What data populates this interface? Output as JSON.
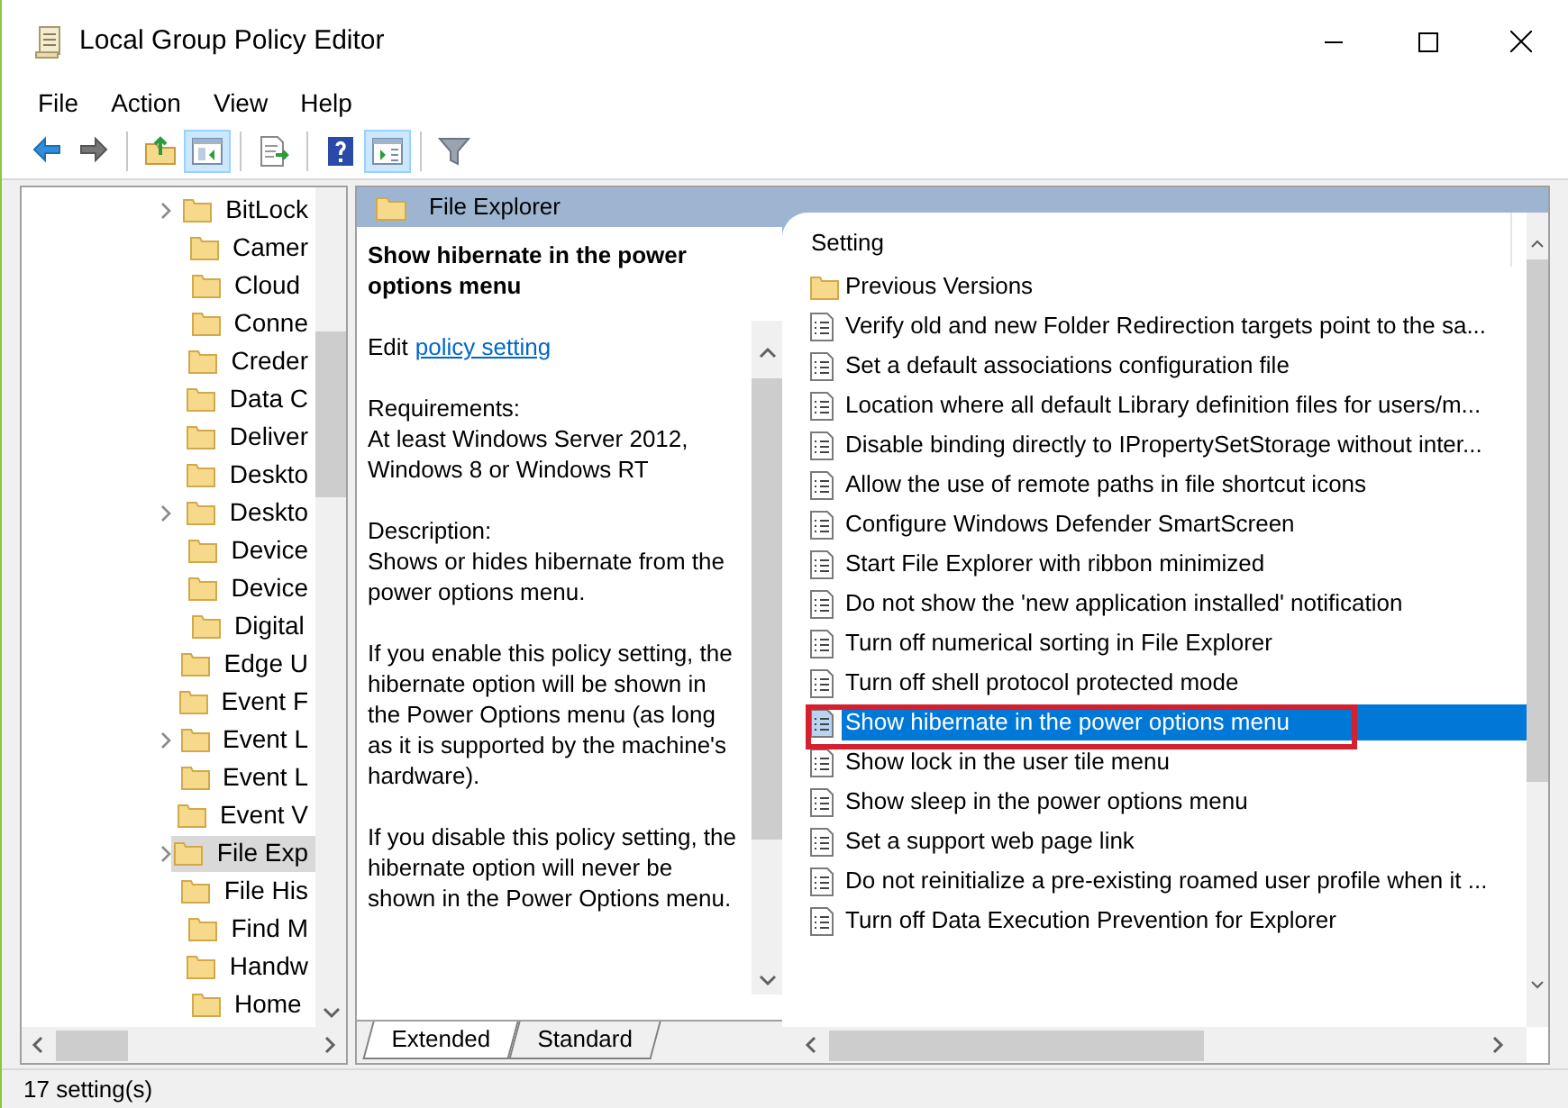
{
  "window": {
    "title": "Local Group Policy Editor"
  },
  "menu": [
    "File",
    "Action",
    "View",
    "Help"
  ],
  "toolbar": [
    {
      "kind": "back",
      "pressed": false
    },
    {
      "kind": "forward",
      "pressed": false
    },
    {
      "kind": "sep"
    },
    {
      "kind": "up",
      "pressed": false
    },
    {
      "kind": "tree",
      "pressed": true
    },
    {
      "kind": "sep"
    },
    {
      "kind": "export",
      "pressed": false
    },
    {
      "kind": "sep"
    },
    {
      "kind": "help",
      "pressed": false
    },
    {
      "kind": "extended",
      "pressed": true
    },
    {
      "kind": "sep"
    },
    {
      "kind": "filter",
      "pressed": false
    }
  ],
  "tree": {
    "items": [
      {
        "label": "BitLock",
        "expandable": true,
        "selected": false
      },
      {
        "label": "Camer",
        "expandable": false,
        "selected": false
      },
      {
        "label": "Cloud",
        "expandable": false,
        "selected": false
      },
      {
        "label": "Conne",
        "expandable": false,
        "selected": false
      },
      {
        "label": "Creder",
        "expandable": false,
        "selected": false
      },
      {
        "label": "Data C",
        "expandable": false,
        "selected": false
      },
      {
        "label": "Deliver",
        "expandable": false,
        "selected": false
      },
      {
        "label": "Deskto",
        "expandable": false,
        "selected": false
      },
      {
        "label": "Deskto",
        "expandable": true,
        "selected": false
      },
      {
        "label": "Device",
        "expandable": false,
        "selected": false
      },
      {
        "label": "Device",
        "expandable": false,
        "selected": false
      },
      {
        "label": "Digital",
        "expandable": false,
        "selected": false
      },
      {
        "label": "Edge U",
        "expandable": false,
        "selected": false
      },
      {
        "label": "Event F",
        "expandable": false,
        "selected": false
      },
      {
        "label": "Event L",
        "expandable": true,
        "selected": false
      },
      {
        "label": "Event L",
        "expandable": false,
        "selected": false
      },
      {
        "label": "Event V",
        "expandable": false,
        "selected": false
      },
      {
        "label": "File Exp",
        "expandable": true,
        "selected": true
      },
      {
        "label": "File His",
        "expandable": false,
        "selected": false
      },
      {
        "label": "Find M",
        "expandable": false,
        "selected": false
      },
      {
        "label": "Handw",
        "expandable": false,
        "selected": false
      },
      {
        "label": "Home",
        "expandable": false,
        "selected": false
      }
    ]
  },
  "details": {
    "header": "File Explorer",
    "title": "Show hibernate in the power options menu",
    "edit_prefix": "Edit",
    "edit_link": "policy setting",
    "paragraphs": [
      "Requirements:\nAt least Windows Server 2012, Windows 8 or Windows RT",
      "Description:\nShows or hides hibernate from the power options menu.",
      "If you enable this policy setting, the hibernate option will be shown in the Power Options menu (as long as it is supported by the machine's hardware).",
      "If you disable this policy setting, the hibernate option will never be shown in the Power Options menu."
    ]
  },
  "settings": {
    "column": "Setting",
    "rows": [
      {
        "kind": "folder",
        "label": "Previous Versions",
        "selected": false,
        "callout": false
      },
      {
        "kind": "policy",
        "label": "Verify old and new Folder Redirection targets point to the sa...",
        "selected": false,
        "callout": false
      },
      {
        "kind": "policy",
        "label": "Set a default associations configuration file",
        "selected": false,
        "callout": false
      },
      {
        "kind": "policy",
        "label": "Location where all default Library definition files for users/m...",
        "selected": false,
        "callout": false
      },
      {
        "kind": "policy",
        "label": "Disable binding directly to IPropertySetStorage without inter...",
        "selected": false,
        "callout": false
      },
      {
        "kind": "policy",
        "label": "Allow the use of remote paths in file shortcut icons",
        "selected": false,
        "callout": false
      },
      {
        "kind": "policy",
        "label": "Configure Windows Defender SmartScreen",
        "selected": false,
        "callout": false
      },
      {
        "kind": "policy",
        "label": "Start File Explorer with ribbon minimized",
        "selected": false,
        "callout": false
      },
      {
        "kind": "policy",
        "label": "Do not show the 'new application installed' notification",
        "selected": false,
        "callout": false
      },
      {
        "kind": "policy",
        "label": "Turn off numerical sorting in File Explorer",
        "selected": false,
        "callout": false
      },
      {
        "kind": "policy",
        "label": "Turn off shell protocol protected mode",
        "selected": false,
        "callout": false
      },
      {
        "kind": "policy",
        "label": "Show hibernate in the power options menu",
        "selected": true,
        "callout": true
      },
      {
        "kind": "policy",
        "label": "Show lock in the user tile menu",
        "selected": false,
        "callout": false
      },
      {
        "kind": "policy",
        "label": "Show sleep in the power options menu",
        "selected": false,
        "callout": false
      },
      {
        "kind": "policy",
        "label": "Set a support web page link",
        "selected": false,
        "callout": false
      },
      {
        "kind": "policy",
        "label": "Do not reinitialize a pre-existing roamed user profile when it ...",
        "selected": false,
        "callout": false
      },
      {
        "kind": "policy",
        "label": "Turn off Data Execution Prevention for Explorer",
        "selected": false,
        "callout": false
      }
    ]
  },
  "tabs": [
    {
      "label": "Extended",
      "selected": true
    },
    {
      "label": "Standard",
      "selected": false
    }
  ],
  "status_bar": "17 setting(s)"
}
